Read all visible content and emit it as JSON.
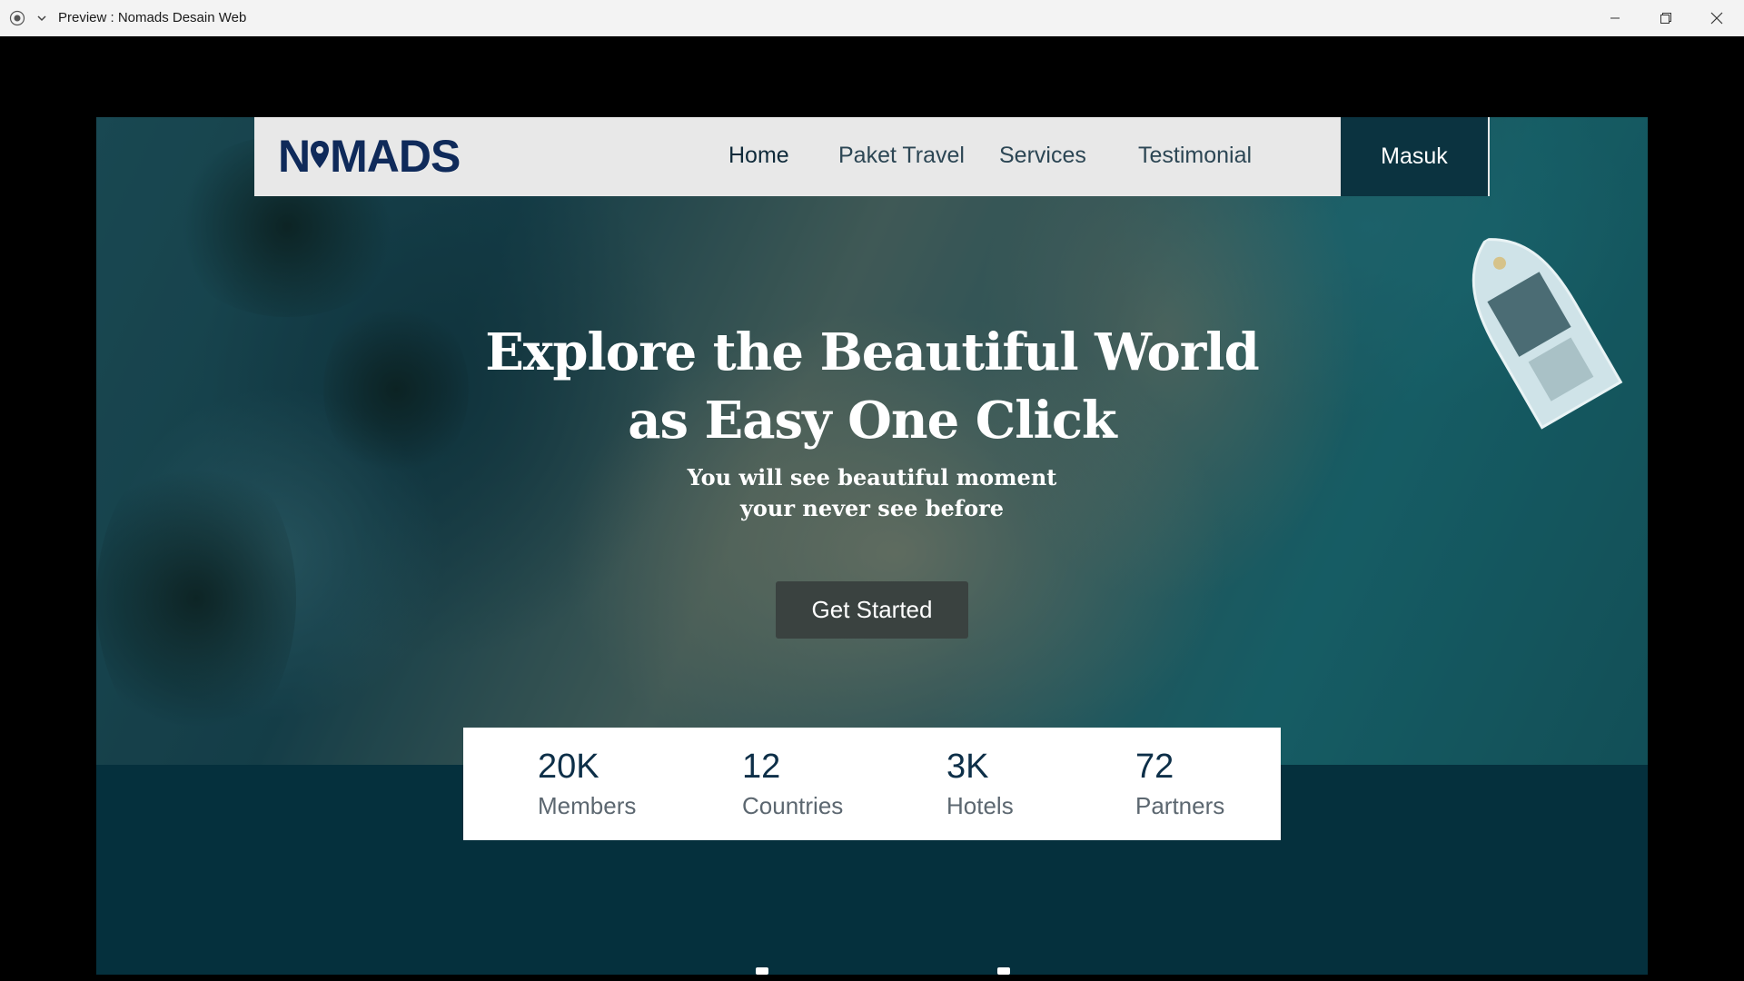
{
  "window": {
    "title": "Preview : Nomads Desain Web",
    "app_icon": "record-icon",
    "dropdown_icon": "chevron-down-icon",
    "controls": [
      "minimize-icon",
      "restore-icon",
      "close-icon"
    ]
  },
  "navbar": {
    "logo": "NOMADS",
    "logo_text_left": "N",
    "logo_text_right": "MADS",
    "items": [
      {
        "label": "Home",
        "active": true
      },
      {
        "label": "Paket Travel",
        "active": false
      },
      {
        "label": "Services",
        "active": false
      },
      {
        "label": "Testimonial",
        "active": false
      }
    ],
    "login_label": "Masuk"
  },
  "hero": {
    "headline_line1": "Explore the Beautiful World",
    "headline_line2": "as Easy One Click",
    "sub_line1": "You will see beautiful moment",
    "sub_line2": "your never see before",
    "cta_label": "Get Started"
  },
  "stats": [
    {
      "value": "20K",
      "label": "Members"
    },
    {
      "value": "12",
      "label": "Countries"
    },
    {
      "value": "3K",
      "label": "Hotels"
    },
    {
      "value": "72",
      "label": "Partners"
    }
  ],
  "colors": {
    "navy": "#0f2a5a",
    "dark_teal": "#05303d",
    "login_bg": "#0b3340",
    "cta_bg": "#3a4240",
    "navbar_bg": "#e8e8e8"
  }
}
